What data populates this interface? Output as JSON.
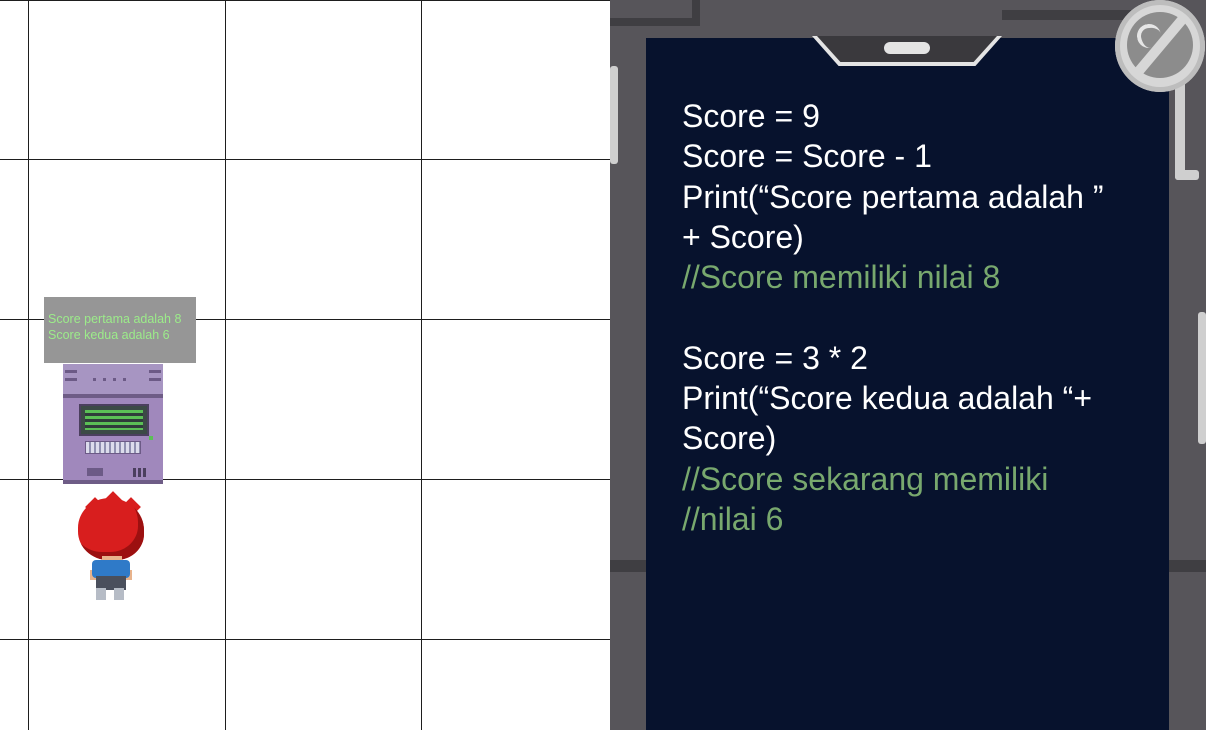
{
  "game": {
    "output_panel": {
      "lines": [
        "Score pertama adalah 8",
        "Score kedua adalah 6"
      ]
    },
    "colors": {
      "output_text": "#9cec8a",
      "output_bg": "#969696",
      "grid_line": "#1e1e1e",
      "computer": "#a088bc",
      "player_hair": "#d81e1e"
    }
  },
  "code_panel": {
    "lines": [
      {
        "text": "Score = 9",
        "type": "code"
      },
      {
        "text": "Score = Score - 1",
        "type": "code"
      },
      {
        "text": "Print(“Score pertama adalah ”",
        "type": "code"
      },
      {
        "text": "+ Score)",
        "type": "code"
      },
      {
        "text": "//Score memiliki nilai 8",
        "type": "comment"
      },
      {
        "text": "",
        "type": "blank"
      },
      {
        "text": "Score = 3 * 2",
        "type": "code"
      },
      {
        "text": "Print(“Score kedua adalah “+",
        "type": "code"
      },
      {
        "text": "Score)",
        "type": "code"
      },
      {
        "text": "//Score sekarang memiliki",
        "type": "comment"
      },
      {
        "text": "//nilai 6",
        "type": "comment"
      }
    ],
    "colors": {
      "screen_bg": "#07122d",
      "code_text": "#ffffff",
      "comment_text": "#78a86e",
      "frame": "#57555a"
    },
    "zoom_icon": "magnifier-icon"
  }
}
